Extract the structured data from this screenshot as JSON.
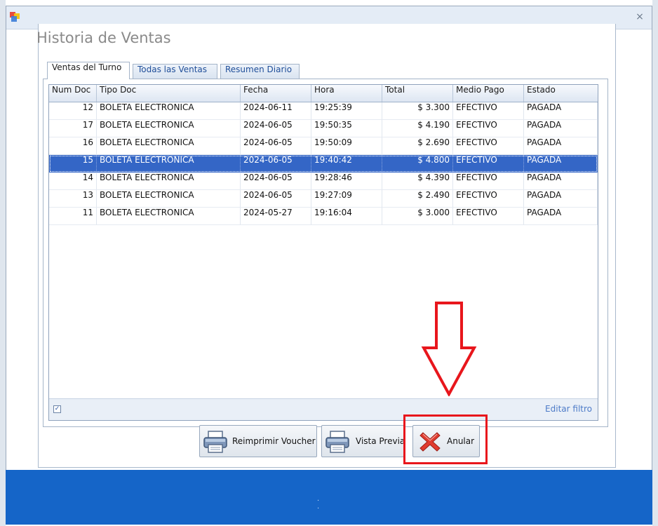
{
  "window": {
    "close_glyph": "×"
  },
  "form": {
    "title": "Historia de Ventas"
  },
  "tabs": [
    {
      "label": "Ventas del Turno",
      "active": true
    },
    {
      "label": "Todas las Ventas",
      "active": false
    },
    {
      "label": "Resumen Diario",
      "active": false
    }
  ],
  "grid": {
    "columns": [
      "Num Doc",
      "Tipo Doc",
      "Fecha",
      "Hora",
      "Total",
      "Medio Pago",
      "Estado"
    ],
    "rows": [
      {
        "num": "12",
        "tipo": "BOLETA ELECTRONICA",
        "fecha": "2024-06-11",
        "hora": "19:25:39",
        "total": "$ 3.300",
        "medio": "EFECTIVO",
        "estado": "PAGADA"
      },
      {
        "num": "17",
        "tipo": "BOLETA ELECTRONICA",
        "fecha": "2024-06-05",
        "hora": "19:50:35",
        "total": "$ 4.190",
        "medio": "EFECTIVO",
        "estado": "PAGADA"
      },
      {
        "num": "16",
        "tipo": "BOLETA ELECTRONICA",
        "fecha": "2024-06-05",
        "hora": "19:50:09",
        "total": "$ 2.690",
        "medio": "EFECTIVO",
        "estado": "PAGADA"
      },
      {
        "num": "15",
        "tipo": "BOLETA ELECTRONICA",
        "fecha": "2024-06-05",
        "hora": "19:40:42",
        "total": "$ 4.800",
        "medio": "EFECTIVO",
        "estado": "PAGADA"
      },
      {
        "num": "14",
        "tipo": "BOLETA ELECTRONICA",
        "fecha": "2024-06-05",
        "hora": "19:28:46",
        "total": "$ 4.390",
        "medio": "EFECTIVO",
        "estado": "PAGADA"
      },
      {
        "num": "13",
        "tipo": "BOLETA ELECTRONICA",
        "fecha": "2024-06-05",
        "hora": "19:27:09",
        "total": "$ 2.490",
        "medio": "EFECTIVO",
        "estado": "PAGADA"
      },
      {
        "num": "11",
        "tipo": "BOLETA ELECTRONICA",
        "fecha": "2024-05-27",
        "hora": "19:16:04",
        "total": "$ 3.000",
        "medio": "EFECTIVO",
        "estado": "PAGADA"
      }
    ],
    "selected_row": 3,
    "filter_checked": true,
    "filter_check_glyph": "✓",
    "filter_edit_label": "Editar filtro"
  },
  "buttons": {
    "reprint_label": "Reimprimir Voucher",
    "preview_label": "Vista Previa",
    "void_label": "Anular"
  },
  "icons": {
    "app": "app-window-icon",
    "reprint": "printer-icon",
    "preview": "printer-icon",
    "void": "red-x-icon",
    "annotation": "down-arrow-icon"
  },
  "colors": {
    "selection": "#3466c6",
    "annotation": "#e8161c",
    "bottom_bar": "#1565c8",
    "tab_text": "#1f4e99"
  },
  "bottom_bar": {
    "text": ". ."
  }
}
